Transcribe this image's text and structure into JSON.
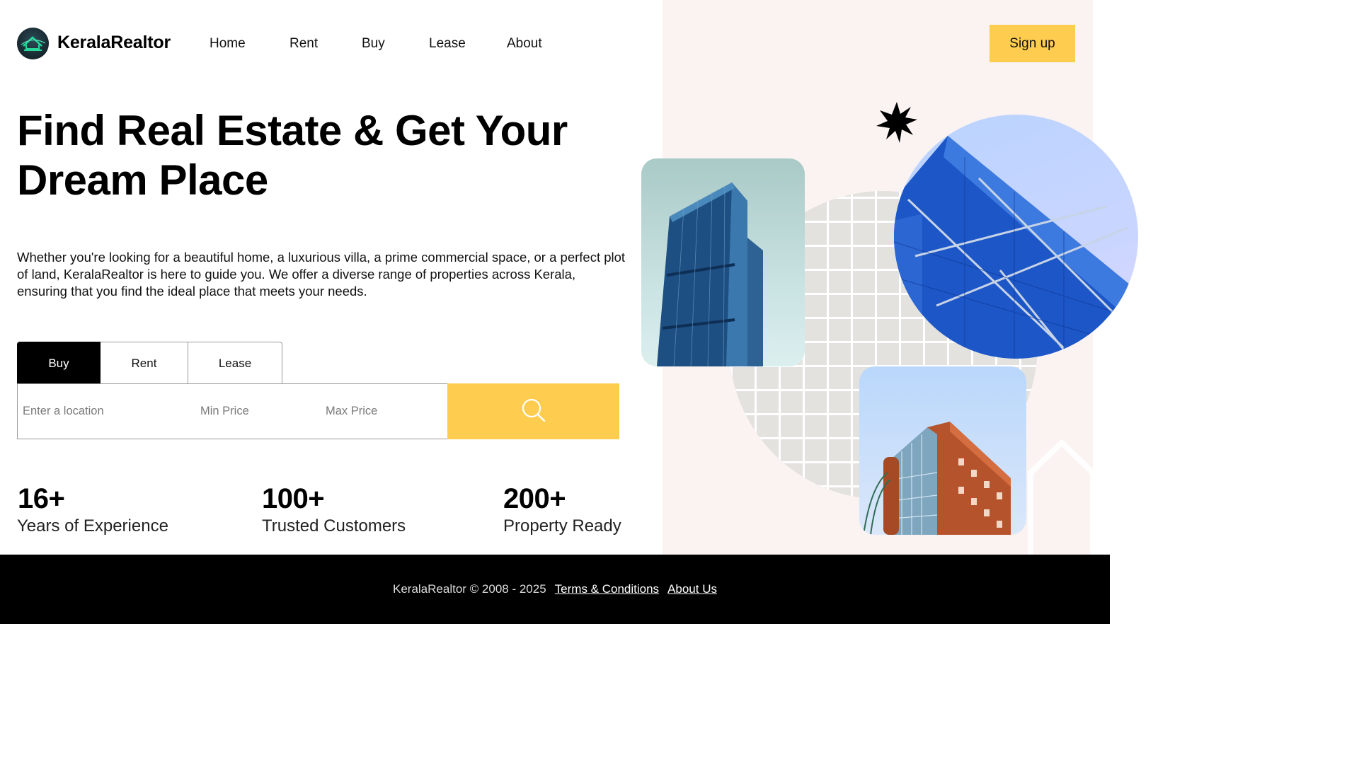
{
  "brand": {
    "name": "KeralaRealtor",
    "logo_icon": "house-logo-icon"
  },
  "nav": [
    "Home",
    "Rent",
    "Buy",
    "Lease",
    "About"
  ],
  "signup_label": "Sign up",
  "hero": {
    "title_line1": "Find Real Estate & Get Your",
    "title_line2": "Dream Place",
    "description": "Whether you're looking for a beautiful home, a luxurious villa, a prime commercial space, or a perfect plot of land, KeralaRealtor is here to guide you. We offer a diverse range of properties across Kerala, ensuring that you find the ideal place that meets your needs."
  },
  "search": {
    "tabs": [
      "Buy",
      "Rent",
      "Lease"
    ],
    "active_tab": "Buy",
    "location_placeholder": "Enter a location",
    "min_price_placeholder": "Min Price",
    "max_price_placeholder": "Max Price",
    "button_icon": "search-icon"
  },
  "stats": [
    {
      "value": "16+",
      "label": "Years of Experience"
    },
    {
      "value": "100+",
      "label": "Trusted Customers"
    },
    {
      "value": "200+",
      "label": "Property Ready"
    }
  ],
  "footer": {
    "copyright": "KeralaRealtor © 2008 - 2025",
    "links": [
      "Terms & Conditions",
      "About Us"
    ]
  },
  "colors": {
    "accent": "#fecd4f",
    "panel_bg": "#fbf3f1",
    "footer_bg": "#000000",
    "active_tab_bg": "#000000"
  }
}
